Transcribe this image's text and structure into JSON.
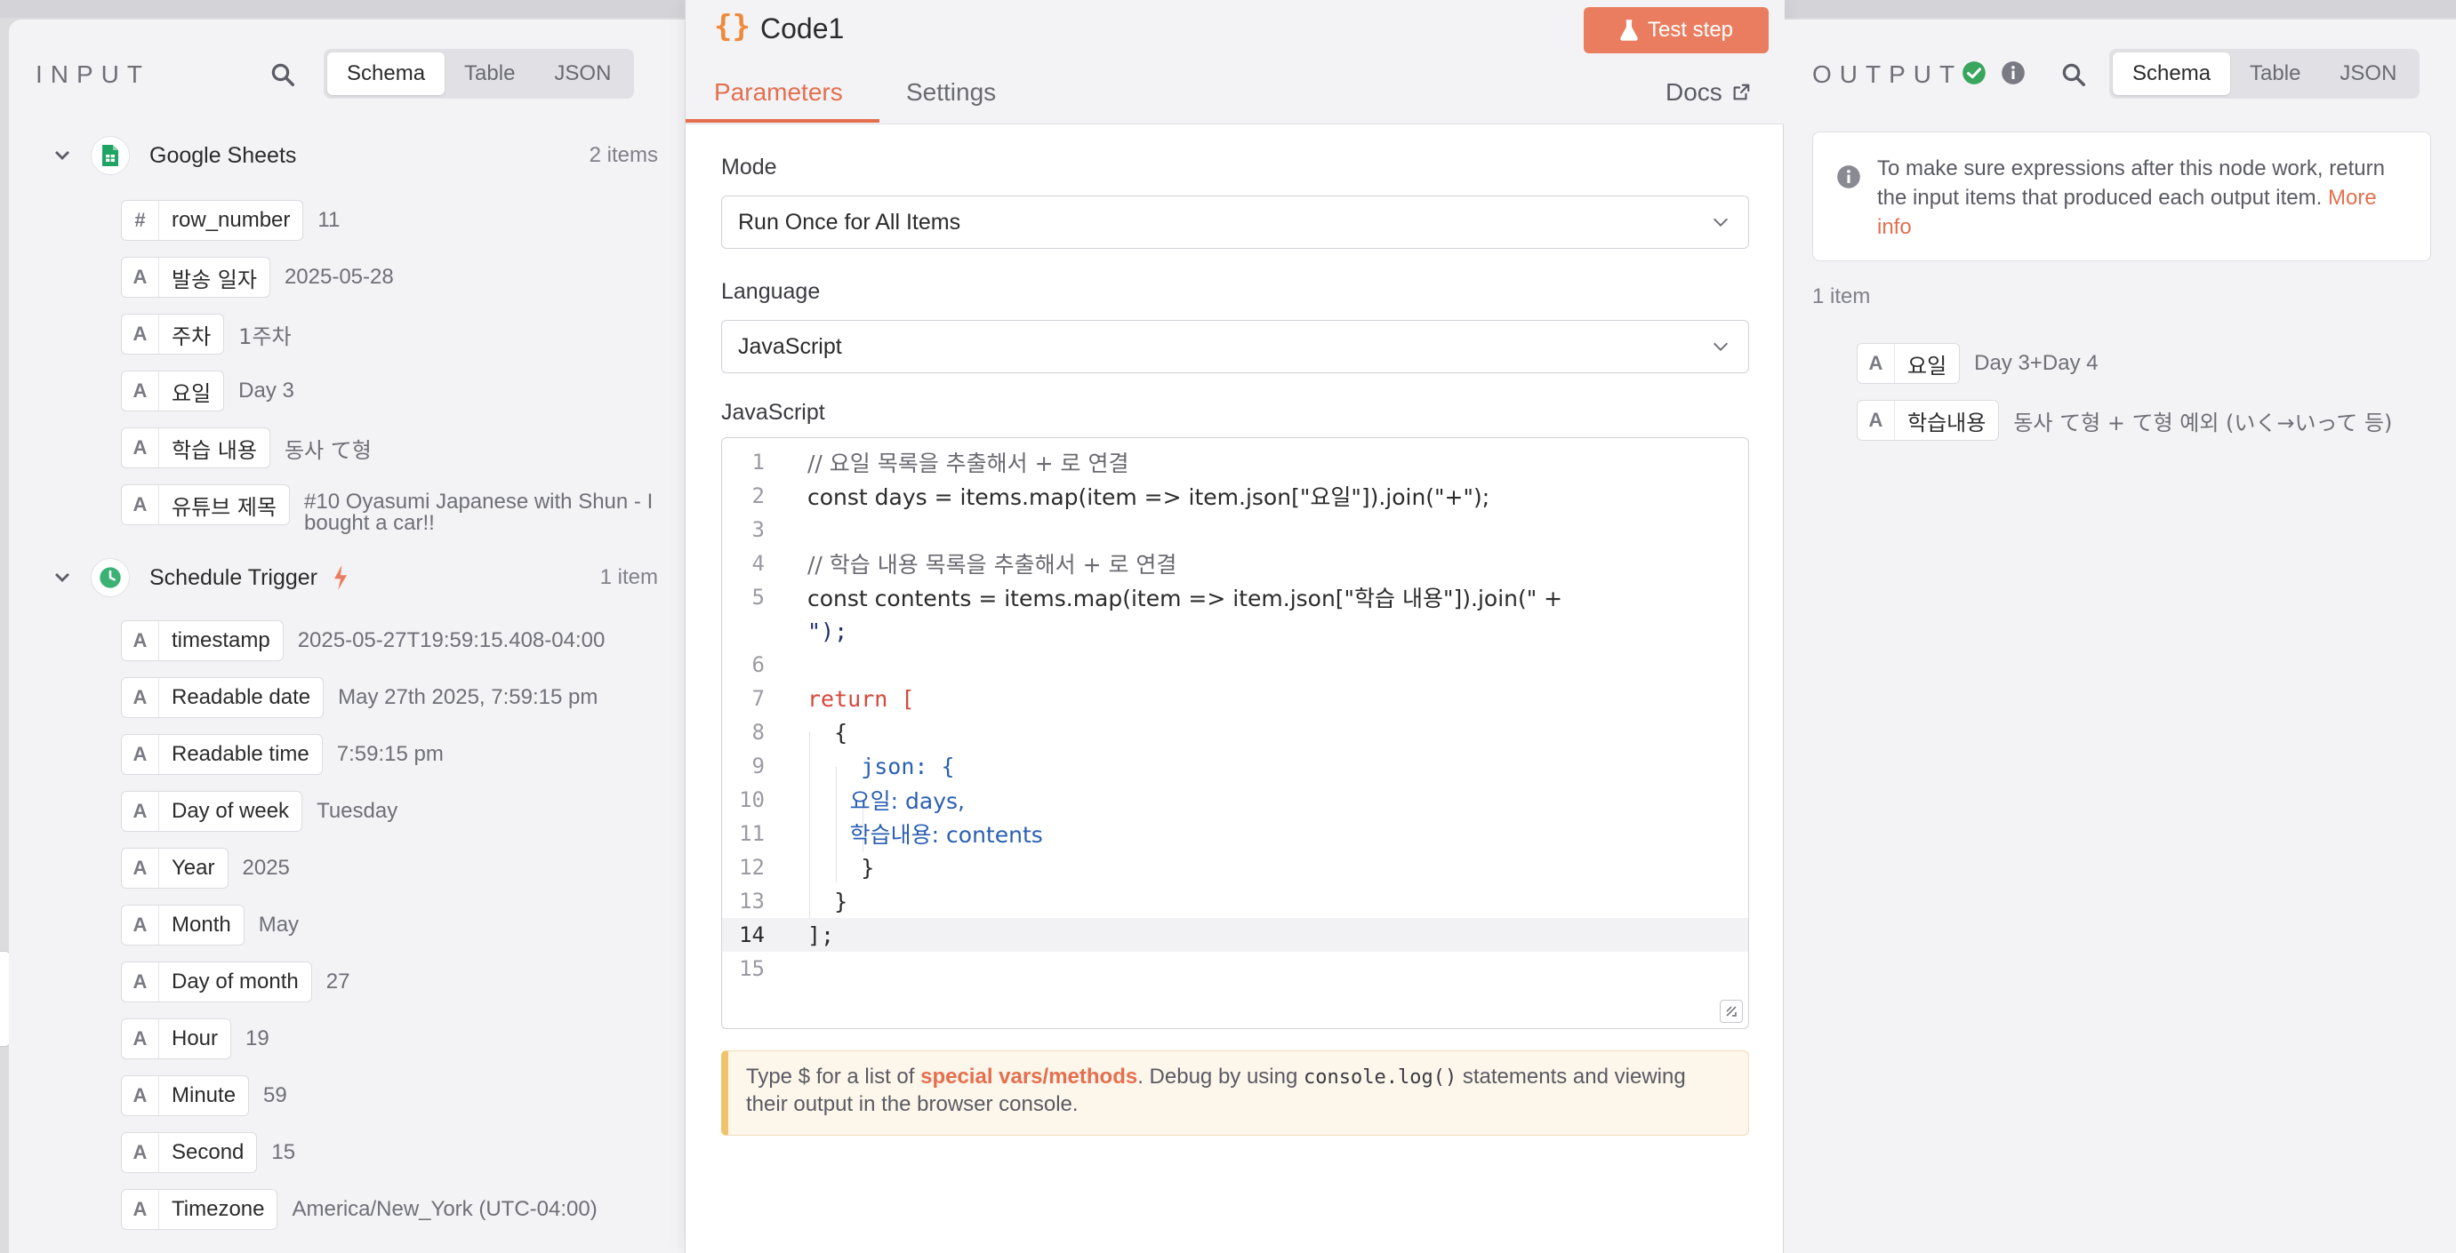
{
  "input": {
    "title": "INPUT",
    "view_tabs": [
      "Schema",
      "Table",
      "JSON"
    ],
    "groups": [
      {
        "name": "Google Sheets",
        "count": "2 items",
        "fields": [
          {
            "type": "#",
            "name": "row_number",
            "value": "11"
          },
          {
            "type": "A",
            "name": "발송 일자",
            "value": "2025-05-28"
          },
          {
            "type": "A",
            "name": "주차",
            "value": "1주차"
          },
          {
            "type": "A",
            "name": "요일",
            "value": "Day 3"
          },
          {
            "type": "A",
            "name": "학습 내용",
            "value": "동사 て형"
          },
          {
            "type": "A",
            "name": "유튜브 제목",
            "value": "#10 Oyasumi Japanese with Shun - I bought a car!!"
          }
        ]
      },
      {
        "name": "Schedule Trigger",
        "count": "1 item",
        "fields": [
          {
            "type": "A",
            "name": "timestamp",
            "value": "2025-05-27T19:59:15.408-04:00"
          },
          {
            "type": "A",
            "name": "Readable date",
            "value": "May 27th 2025, 7:59:15 pm"
          },
          {
            "type": "A",
            "name": "Readable time",
            "value": "7:59:15 pm"
          },
          {
            "type": "A",
            "name": "Day of week",
            "value": "Tuesday"
          },
          {
            "type": "A",
            "name": "Year",
            "value": "2025"
          },
          {
            "type": "A",
            "name": "Month",
            "value": "May"
          },
          {
            "type": "A",
            "name": "Day of month",
            "value": "27"
          },
          {
            "type": "A",
            "name": "Hour",
            "value": "19"
          },
          {
            "type": "A",
            "name": "Minute",
            "value": "59"
          },
          {
            "type": "A",
            "name": "Second",
            "value": "15"
          },
          {
            "type": "A",
            "name": "Timezone",
            "value": "America/New_York (UTC-04:00)"
          }
        ]
      }
    ]
  },
  "node": {
    "title": "Code1",
    "test_step_label": "Test step",
    "tabs": [
      "Parameters",
      "Settings"
    ],
    "docs_label": "Docs",
    "mode": {
      "label": "Mode",
      "value": "Run Once for All Items"
    },
    "language": {
      "label": "Language",
      "value": "JavaScript"
    },
    "editor": {
      "label": "JavaScript",
      "current_line": 14,
      "lines": [
        "// 요일 목록을 추출해서 + 로 연결",
        "const days = items.map(item => item.json[\"요일\"]).join(\"+\");",
        "",
        "// 학습 내용 목록을 추출해서 + 로 연결",
        "const contents = items.map(item => item.json[\"학습 내용\"]).join(\" +",
        "\");",
        "",
        "return [",
        "  {",
        "    json: {",
        "      요일: days,",
        "      학습내용: contents",
        "    }",
        "  }",
        "];",
        ""
      ],
      "line_numbers": [
        "1",
        "2",
        "3",
        "4",
        "5",
        "",
        "6",
        "7",
        "8",
        "9",
        "10",
        "11",
        "12",
        "13",
        "14",
        "15"
      ]
    },
    "hint": {
      "prefix": "Type $ for a list of ",
      "link": "special vars/methods",
      "middle": ". Debug by using ",
      "code": "console.log()",
      "suffix": " statements and viewing their output in the browser console."
    }
  },
  "output": {
    "title": "OUTPUT",
    "view_tabs": [
      "Schema",
      "Table",
      "JSON"
    ],
    "notice": "To make sure expressions after this node work, return the input items that produced each output item.",
    "notice_link": "More info",
    "count": "1 item",
    "fields": [
      {
        "type": "A",
        "name": "요일",
        "value": "Day 3+Day 4"
      },
      {
        "type": "A",
        "name": "학습내용",
        "value": "동사 て형 + て형 예외 (いく→いって 등)"
      }
    ]
  },
  "colors": {
    "accent": "#e46f4f",
    "test_button": "#ea7d5f",
    "success": "#3aa55d",
    "sheets_green": "#1fa463",
    "trigger_green": "#3bb273"
  }
}
